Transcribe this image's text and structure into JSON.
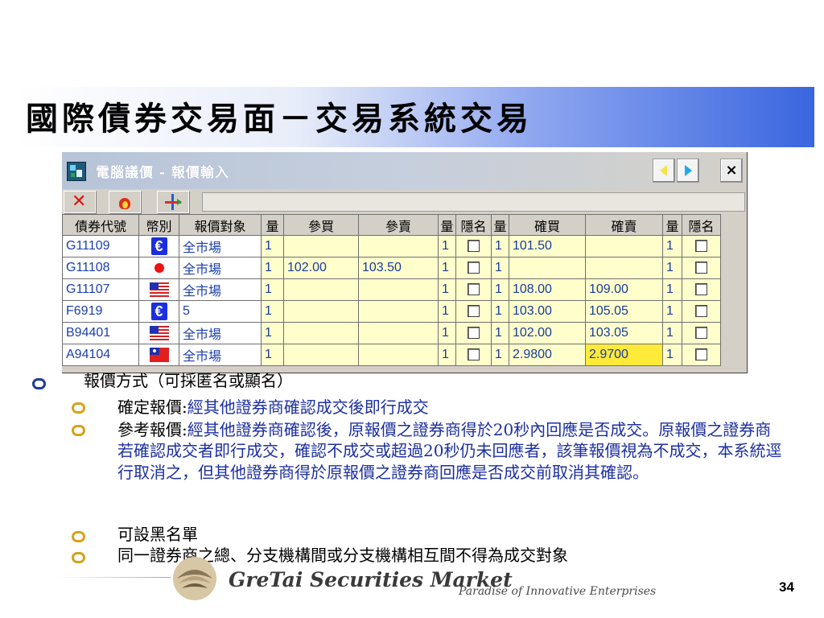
{
  "slide": {
    "title": "國際債券交易面－交易系統交易",
    "page_number": "34",
    "footer_brand": "GreTai Securities Market",
    "footer_tagline": "Paradise of Innovative Enterprises"
  },
  "window": {
    "title": "電腦議價 - 報價輸入",
    "close_label": "×"
  },
  "table": {
    "headers": [
      "債券代號",
      "幣別",
      "報價對象",
      "量",
      "參買",
      "參賣",
      "量",
      "隱名",
      "量",
      "確買",
      "確賣",
      "量",
      "隱名"
    ],
    "rows": [
      {
        "code": "G11109",
        "currency_icon": "euro-icon",
        "target": "全市場",
        "qty1": "1",
        "ref_buy": "",
        "ref_sell": "",
        "qty2": "1",
        "anon1": false,
        "qty3": "1",
        "firm_buy": "101.50",
        "firm_sell": "",
        "qty4": "1",
        "anon2": false
      },
      {
        "code": "G11108",
        "currency_icon": "japan-flag-icon",
        "target": "全市場",
        "qty1": "1",
        "ref_buy": "102.00",
        "ref_sell": "103.50",
        "qty2": "1",
        "anon1": false,
        "qty3": "1",
        "firm_buy": "",
        "firm_sell": "",
        "qty4": "1",
        "anon2": false
      },
      {
        "code": "G11107",
        "currency_icon": "us-flag-icon",
        "target": "全市場",
        "qty1": "1",
        "ref_buy": "",
        "ref_sell": "",
        "qty2": "1",
        "anon1": false,
        "qty3": "1",
        "firm_buy": "108.00",
        "firm_sell": "109.00",
        "qty4": "1",
        "anon2": false
      },
      {
        "code": "F6919",
        "currency_icon": "euro-icon",
        "target": "5",
        "qty1": "1",
        "ref_buy": "",
        "ref_sell": "",
        "qty2": "1",
        "anon1": false,
        "qty3": "1",
        "firm_buy": "103.00",
        "firm_sell": "105.05",
        "qty4": "1",
        "anon2": false
      },
      {
        "code": "B94401",
        "currency_icon": "us-flag-icon",
        "target": "全市場",
        "qty1": "1",
        "ref_buy": "",
        "ref_sell": "",
        "qty2": "1",
        "anon1": false,
        "qty3": "1",
        "firm_buy": "102.00",
        "firm_sell": "103.05",
        "qty4": "1",
        "anon2": false
      },
      {
        "code": "A94104",
        "currency_icon": "taiwan-flag-icon",
        "target": "全市場",
        "qty1": "1",
        "ref_buy": "",
        "ref_sell": "",
        "qty2": "1",
        "anon1": false,
        "qty3": "1",
        "firm_buy": "2.9800",
        "firm_sell": "2.9700",
        "qty4": "1",
        "anon2": false
      }
    ]
  },
  "content": {
    "main_bullet": "報價方式（可採匿名或顯名）",
    "sub1_label": "確定報價:",
    "sub1_text": "經其他證券商確認成交後即行成交",
    "sub2_label": "參考報價:",
    "sub2_text": "經其他證券商確認後，原報價之證券商得於20秒內回應是否成交。原報價之證券商若確認成交者即行成交，確認不成交或超過20秒仍未回應者，該筆報價視為不成交，本系統逕行取消之，但其他證券商得於原報價之證券商回應是否成交前取消其確認。",
    "sub3": "可設黑名單",
    "sub4": "同一證券商之總、分支機構間或分支機構相互間不得為成交對象"
  },
  "colors": {
    "title_band_end": "#3a66e0",
    "bullet_main": "#1e3b9c",
    "bullet_sub": "#d6a21a",
    "link_blue": "#1c2fa0",
    "grid_yellow": "#ffffcc",
    "highlight_yellow": "#ffea3a"
  }
}
